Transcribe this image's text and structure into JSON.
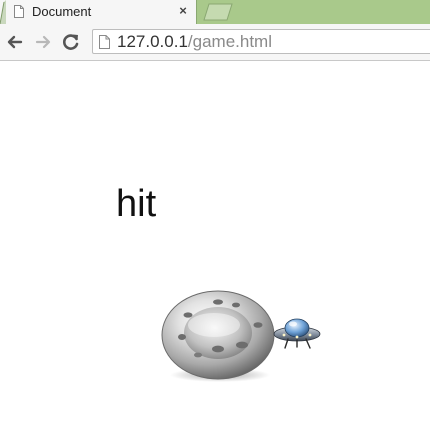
{
  "tab": {
    "title": "Document",
    "close_glyph": "×",
    "page_icon": "page-icon",
    "close_icon": "close-icon"
  },
  "toolbar": {
    "back_icon": "arrow-left-icon",
    "forward_icon": "arrow-right-icon",
    "reload_icon": "reload-icon"
  },
  "address_bar": {
    "host": "127.0.0.1",
    "path": "/game.html",
    "page_icon": "page-icon"
  },
  "game": {
    "status_text": "hit",
    "target_icon": "bullseye-disc-icon",
    "player_icon": "ufo-icon"
  },
  "colors": {
    "tabstrip_bg": "#a9c98b",
    "tab_active_bg": "#f6f6f6",
    "toolbar_bg": "#f6f6f6",
    "page_bg": "#ffffff",
    "url_dim": "#8a8a8a"
  }
}
